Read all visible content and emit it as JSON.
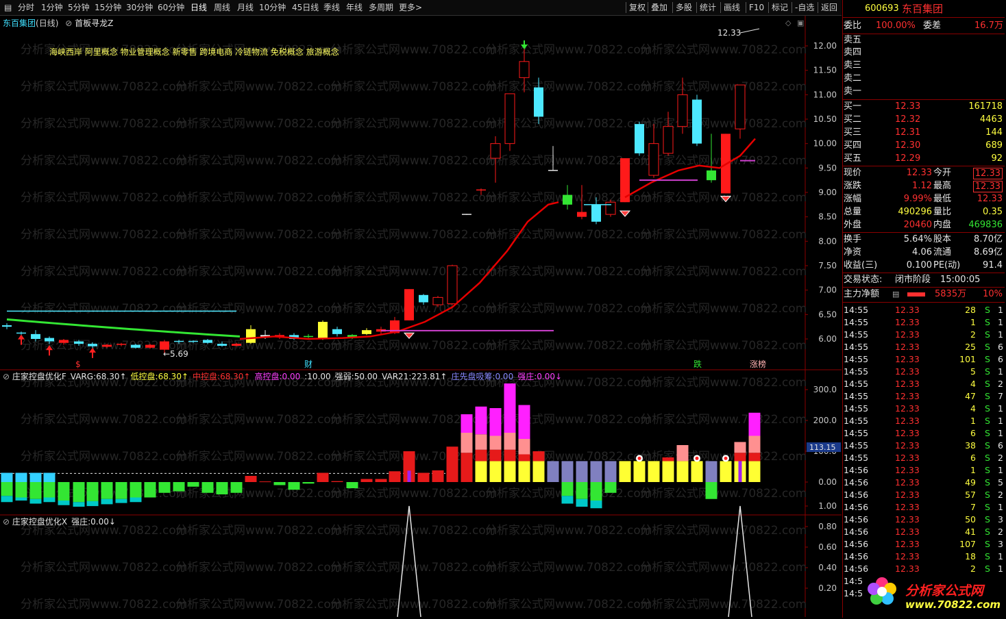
{
  "toolbar": {
    "left_items": [
      "分时",
      "1分钟",
      "5分钟",
      "15分钟",
      "30分钟",
      "60分钟",
      "日线",
      "周线",
      "月线",
      "10分钟",
      "45日线",
      "季线",
      "年线",
      "多周期",
      "更多>"
    ],
    "active": "日线",
    "right_items": [
      "复权",
      "叠加",
      "多股",
      "统计",
      "画线",
      "F10",
      "标记",
      "-自选",
      "返回"
    ]
  },
  "chart": {
    "stock_title": "东百集团",
    "period": "(日线)",
    "indicator": "首板寻龙Z",
    "concepts": "海峡西岸 阿里概念 物业管理概念 新零售 跨境电商 冷链物流 免税概念 旅游概念",
    "high_marker": "12.33",
    "low_marker": "5.69",
    "price_ticks": [
      "12.00",
      "11.50",
      "11.00",
      "10.50",
      "10.00",
      "9.50",
      "9.00",
      "8.50",
      "8.00",
      "7.50",
      "7.00",
      "6.50",
      "6.00"
    ],
    "bottom_labels": [
      "$",
      "财",
      "跌",
      "涨榜"
    ],
    "watermark": "分析家公式网www.70822.com"
  },
  "pane2": {
    "name": "庄家控盘优化F",
    "items": [
      {
        "label": "VARG:",
        "value": "68.30",
        "color": "#e6e6e6",
        "arrow": "↑"
      },
      {
        "label": "低控盘:",
        "value": "68.30",
        "color": "#ffff40",
        "arrow": "↑"
      },
      {
        "label": "中控盘:",
        "value": "68.30",
        "color": "#ff3030",
        "arrow": "↑"
      },
      {
        "label": "高控盘:",
        "value": "0.00",
        "color": "#ff40ff",
        "arrow": ""
      },
      {
        "label": ":",
        "value": "10.00",
        "color": "#e6e6e6",
        "arrow": ""
      },
      {
        "label": "强弱:",
        "value": "50.00",
        "color": "#e6e6e6",
        "arrow": ""
      },
      {
        "label": "VAR21:",
        "value": "223.81",
        "color": "#e6e6e6",
        "arrow": "↑"
      },
      {
        "label": "庄先盘吸筹:",
        "value": "0.00",
        "color": "#8888ff",
        "arrow": ""
      },
      {
        "label": "强庄:",
        "value": "0.00",
        "color": "#ff40ff",
        "arrow": "↓"
      }
    ],
    "ticks": [
      "300.0",
      "200.0",
      "100.0",
      "0.00"
    ],
    "current_value": "113.15"
  },
  "pane3": {
    "name": "庄家控盘优化X",
    "label": "强庄:",
    "value": "0.00",
    "arrow": "↓",
    "ticks": [
      "1.00",
      "0.80",
      "0.60",
      "0.40",
      "0.20"
    ]
  },
  "panel": {
    "code": "600693",
    "name": "东百集团",
    "weibi_label": "委比",
    "weibi_value": "100.00%",
    "weicha_label": "委差",
    "weicha_value": "16.7万",
    "sell": [
      {
        "label": "卖五",
        "price": "",
        "vol": ""
      },
      {
        "label": "卖四",
        "price": "",
        "vol": ""
      },
      {
        "label": "卖三",
        "price": "",
        "vol": ""
      },
      {
        "label": "卖二",
        "price": "",
        "vol": ""
      },
      {
        "label": "卖一",
        "price": "",
        "vol": ""
      }
    ],
    "buy": [
      {
        "label": "买一",
        "price": "12.33",
        "vol": "161718"
      },
      {
        "label": "买二",
        "price": "12.32",
        "vol": "4463"
      },
      {
        "label": "买三",
        "price": "12.31",
        "vol": "144"
      },
      {
        "label": "买四",
        "price": "12.30",
        "vol": "689"
      },
      {
        "label": "买五",
        "price": "12.29",
        "vol": "92"
      }
    ],
    "quote": [
      {
        "l1": "现价",
        "v1": "12.33",
        "c1": "red",
        "l2": "今开",
        "v2": "12.33",
        "c2": "red",
        "box": true
      },
      {
        "l1": "涨跌",
        "v1": "1.12",
        "c1": "red",
        "l2": "最高",
        "v2": "12.33",
        "c2": "red",
        "box": true
      },
      {
        "l1": "涨幅",
        "v1": "9.99%",
        "c1": "red",
        "l2": "最低",
        "v2": "12.33",
        "c2": "red",
        "box": false
      },
      {
        "l1": "总量",
        "v1": "490296",
        "c1": "yellow",
        "l2": "量比",
        "v2": "0.35",
        "c2": "yellow",
        "box": false
      },
      {
        "l1": "外盘",
        "v1": "20460",
        "c1": "red",
        "l2": "内盘",
        "v2": "469836",
        "c2": "green",
        "box": false
      }
    ],
    "fund": [
      {
        "l1": "换手",
        "v1": "5.64%",
        "l2": "股本",
        "v2": "8.70亿"
      },
      {
        "l1": "净资",
        "v1": "4.06",
        "l2": "流通",
        "v2": "8.69亿"
      },
      {
        "l1": "收益(三)",
        "v1": "0.100",
        "l2": "PE(动)",
        "v2": "91.4"
      }
    ],
    "status_label": "交易状态:",
    "status_value": "闭市阶段",
    "status_time": "15:00:05",
    "net_label": "主力净额",
    "net_value": "5835万",
    "net_pct": "10%",
    "ticks": [
      {
        "t": "14:55",
        "p": "12.33",
        "v": "28",
        "s": "S",
        "n": "1"
      },
      {
        "t": "14:55",
        "p": "12.33",
        "v": "1",
        "s": "S",
        "n": "1"
      },
      {
        "t": "14:55",
        "p": "12.33",
        "v": "2",
        "s": "S",
        "n": "1"
      },
      {
        "t": "14:55",
        "p": "12.33",
        "v": "25",
        "s": "S",
        "n": "6"
      },
      {
        "t": "14:55",
        "p": "12.33",
        "v": "101",
        "s": "S",
        "n": "6"
      },
      {
        "t": "14:55",
        "p": "12.33",
        "v": "5",
        "s": "S",
        "n": "1"
      },
      {
        "t": "14:55",
        "p": "12.33",
        "v": "4",
        "s": "S",
        "n": "2"
      },
      {
        "t": "14:55",
        "p": "12.33",
        "v": "47",
        "s": "S",
        "n": "7"
      },
      {
        "t": "14:55",
        "p": "12.33",
        "v": "4",
        "s": "S",
        "n": "1"
      },
      {
        "t": "14:55",
        "p": "12.33",
        "v": "1",
        "s": "S",
        "n": "1"
      },
      {
        "t": "14:55",
        "p": "12.33",
        "v": "6",
        "s": "S",
        "n": "1"
      },
      {
        "t": "14:55",
        "p": "12.33",
        "v": "38",
        "s": "S",
        "n": "6"
      },
      {
        "t": "14:55",
        "p": "12.33",
        "v": "6",
        "s": "S",
        "n": "2"
      },
      {
        "t": "14:56",
        "p": "12.33",
        "v": "1",
        "s": "S",
        "n": "1"
      },
      {
        "t": "14:56",
        "p": "12.33",
        "v": "49",
        "s": "S",
        "n": "5"
      },
      {
        "t": "14:56",
        "p": "12.33",
        "v": "57",
        "s": "S",
        "n": "2"
      },
      {
        "t": "14:56",
        "p": "12.33",
        "v": "7",
        "s": "S",
        "n": "1"
      },
      {
        "t": "14:56",
        "p": "12.33",
        "v": "50",
        "s": "S",
        "n": "3"
      },
      {
        "t": "14:56",
        "p": "12.33",
        "v": "41",
        "s": "S",
        "n": "2"
      },
      {
        "t": "14:56",
        "p": "12.33",
        "v": "107",
        "s": "S",
        "n": "3"
      },
      {
        "t": "14:56",
        "p": "12.33",
        "v": "18",
        "s": "S",
        "n": "1"
      },
      {
        "t": "14:56",
        "p": "12.33",
        "v": "2",
        "s": "S",
        "n": "1"
      },
      {
        "t": "14:5",
        "p": "",
        "v": "",
        "s": "",
        "n": ""
      },
      {
        "t": "14:5",
        "p": "",
        "v": "",
        "s": "",
        "n": ""
      }
    ],
    "logo_text": "分析家公式网",
    "logo_url": "www.70822.com"
  }
}
